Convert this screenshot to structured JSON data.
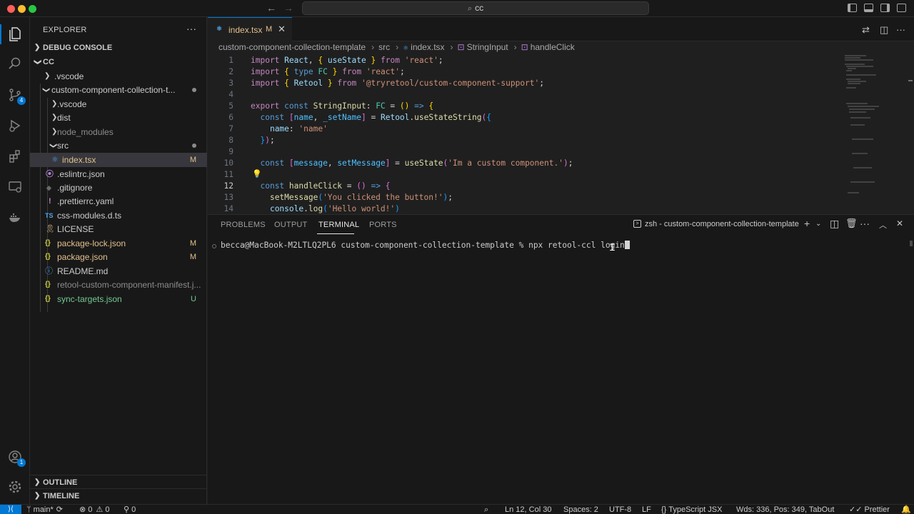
{
  "titlebar": {
    "search_label": "cc",
    "colors": {
      "close": "#ff5f57",
      "minimize": "#febc2e",
      "maximize": "#28c840"
    }
  },
  "activity": {
    "source_control_badge": "4",
    "accounts_badge": "1"
  },
  "sidebar": {
    "title": "EXPLORER",
    "more": "···",
    "debug_console": "DEBUG CONSOLE",
    "root": "CC",
    "items": [
      {
        "label": ".vscode",
        "type": "folder"
      },
      {
        "label": "custom-component-collection-t...",
        "type": "folder-open"
      },
      {
        "label": ".vscode",
        "type": "folder"
      },
      {
        "label": "dist",
        "type": "folder"
      },
      {
        "label": "node_modules",
        "type": "folder"
      },
      {
        "label": "src",
        "type": "folder-open"
      },
      {
        "label": "index.tsx",
        "status": "M"
      },
      {
        "label": ".eslintrc.json",
        "icon": "⦿"
      },
      {
        "label": ".gitignore",
        "icon": "◆"
      },
      {
        "label": ".prettierrc.yaml",
        "icon": "!"
      },
      {
        "label": "css-modules.d.ts",
        "icon": "TS"
      },
      {
        "label": "LICENSE",
        "icon": "🎗"
      },
      {
        "label": "package-lock.json",
        "icon": "{}",
        "status": "M"
      },
      {
        "label": "package.json",
        "icon": "{}",
        "status": "M"
      },
      {
        "label": "README.md",
        "icon": "ⓘ"
      },
      {
        "label": "retool-custom-component-manifest.j...",
        "icon": "{}"
      },
      {
        "label": "sync-targets.json",
        "icon": "{}",
        "status": "U"
      }
    ],
    "outline": "OUTLINE",
    "timeline": "TIMELINE"
  },
  "editor": {
    "tab": {
      "label": "index.tsx",
      "status": "M",
      "icon": "⚛"
    },
    "breadcrumbs": [
      "custom-component-collection-template",
      "src",
      "index.tsx",
      "StringInput",
      "handleClick"
    ],
    "line_numbers": [
      "1",
      "2",
      "3",
      "4",
      "5",
      "6",
      "7",
      "8",
      "9",
      "10",
      "11",
      "12",
      "13",
      "14"
    ],
    "current_line": "12"
  },
  "panel": {
    "tabs": [
      "PROBLEMS",
      "OUTPUT",
      "TERMINAL",
      "PORTS"
    ],
    "active_tab": "TERMINAL",
    "terminal_name": "zsh - custom-component-collection-template",
    "prompt": "becca@MacBook-M2LTLQ2PL6 custom-component-collection-template % ",
    "command": "npx retool-ccl login"
  },
  "statusbar": {
    "branch": "main*",
    "errors": "0",
    "warnings": "0",
    "ports": "0",
    "position": "Ln 12, Col 30",
    "spaces": "Spaces: 2",
    "encoding": "UTF-8",
    "eol": "LF",
    "language": "TypeScript JSX",
    "word_count": "Wds: 336, Pos: 349, TabOut",
    "formatter": "Prettier",
    "accent": "#0078d4"
  }
}
